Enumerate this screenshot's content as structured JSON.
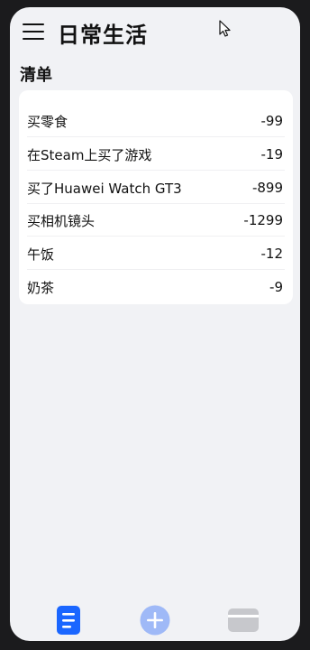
{
  "header": {
    "title": "日常生活"
  },
  "list": {
    "section_title": "清单",
    "items": [
      {
        "name": "买零食",
        "amount": "-99"
      },
      {
        "name": "在Steam上买了游戏",
        "amount": "-19"
      },
      {
        "name": "买了Huawei Watch GT3",
        "amount": "-899"
      },
      {
        "name": "买相机镜头",
        "amount": "-1299"
      },
      {
        "name": "午饭",
        "amount": "-12"
      },
      {
        "name": "奶茶",
        "amount": "-9"
      }
    ]
  },
  "tabbar": {
    "tabs": [
      {
        "icon": "list-icon",
        "active": true,
        "color": "#1a66ff"
      },
      {
        "icon": "add-icon",
        "active": false,
        "color": "#9fb9f7"
      },
      {
        "icon": "card-icon",
        "active": false,
        "color": "#c7c8cc"
      }
    ]
  },
  "colors": {
    "accent": "#1a66ff",
    "background": "#f1f2f5",
    "card": "#ffffff"
  }
}
